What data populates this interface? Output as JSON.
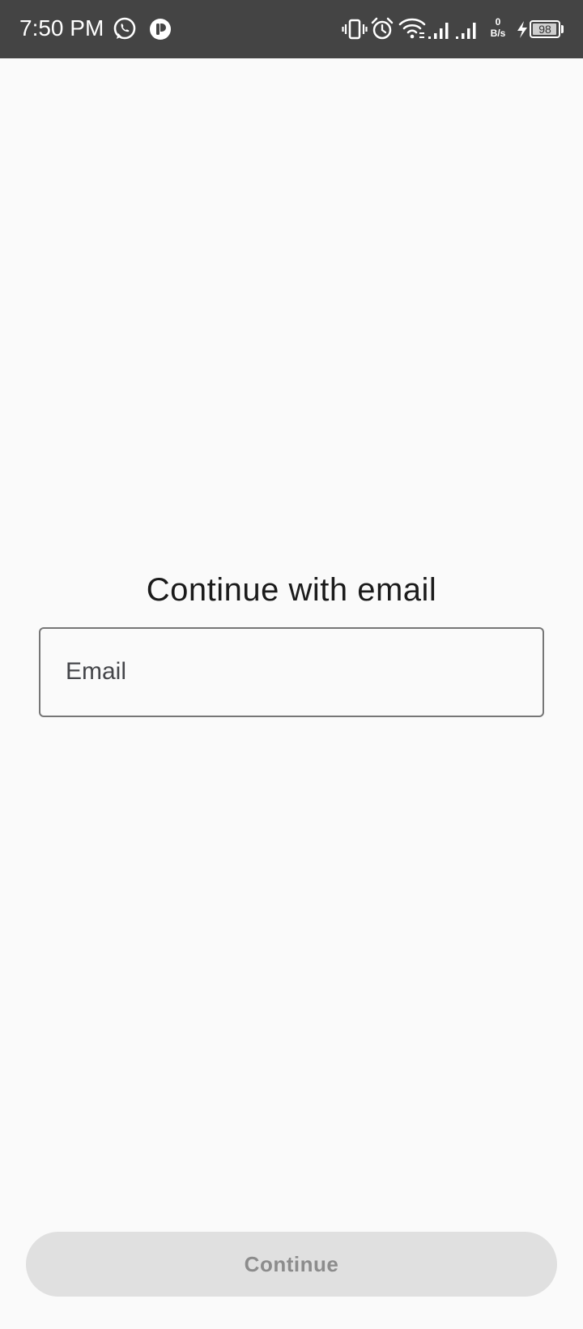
{
  "status_bar": {
    "time": "7:50 PM",
    "net_speed_value": "0",
    "net_speed_unit": "B/s",
    "battery_level": 98,
    "battery_label": "98",
    "icons": [
      "whatsapp-icon",
      "app-notification-icon",
      "vibrate-icon",
      "alarm-icon",
      "wifi-icon",
      "signal-icon",
      "signal-icon",
      "charging-icon",
      "battery-icon"
    ]
  },
  "main": {
    "heading": "Continue with email",
    "email_field": {
      "placeholder": "Email",
      "value": ""
    }
  },
  "footer": {
    "continue_label": "Continue"
  },
  "colors": {
    "background": "#fafafa",
    "status_bar": "#444444",
    "button_disabled_bg": "#e0e0e0",
    "button_disabled_text": "#8c8c8c",
    "field_border": "#767676"
  }
}
